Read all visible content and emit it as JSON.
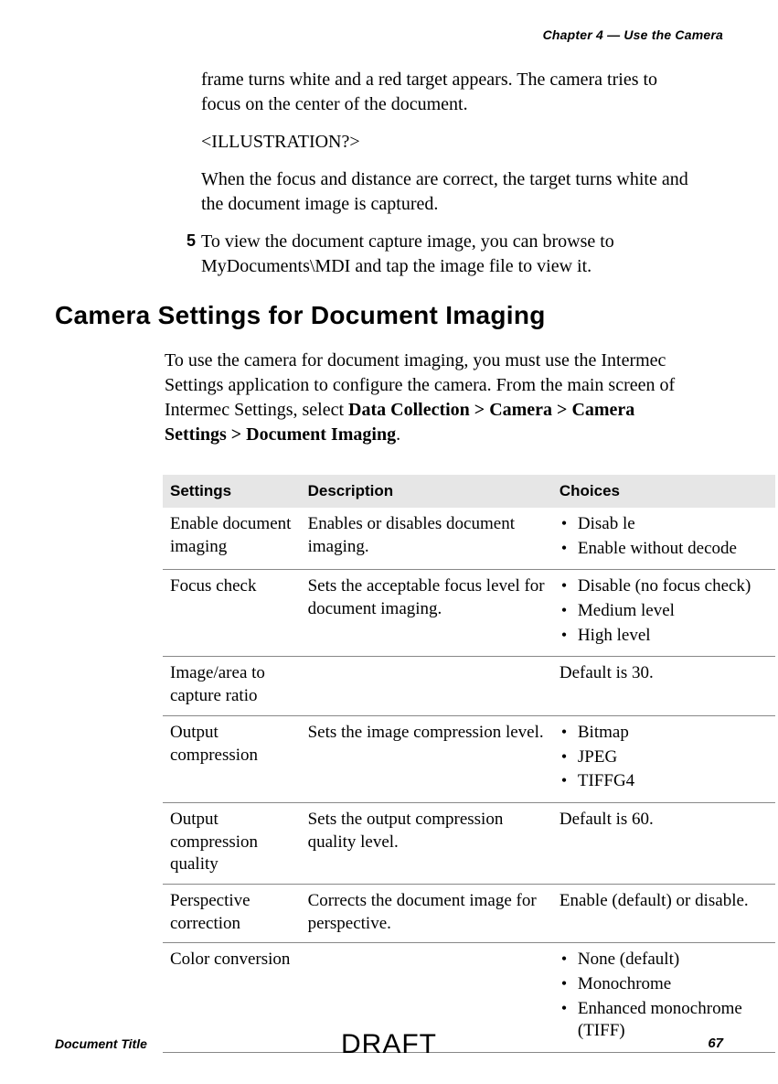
{
  "header": {
    "chapter": "Chapter 4 — Use the Camera"
  },
  "body": {
    "p1": "frame turns white and a red target appears. The camera tries to focus on the center of the document.",
    "p2": "<ILLUSTRATION?>",
    "p3": "When the focus and distance are correct, the target turns white and the document image is captured.",
    "step5_num": "5",
    "step5_text": "To view the document capture image, you can browse to MyDocuments\\MDI and tap the image file to view it."
  },
  "section": {
    "heading": "Camera Settings for Document Imaging",
    "intro_prefix": "To use the camera for document imaging, you must use the Intermec Settings application to configure the camera. From the main screen of Intermec Settings, select ",
    "intro_bold": "Data Collection > Camera > Camera Settings > Document Imaging",
    "intro_suffix": "."
  },
  "table": {
    "headers": {
      "c1": "Settings",
      "c2": "Description",
      "c3": "Choices"
    },
    "rows": [
      {
        "setting": "Enable document imaging",
        "desc": "Enables or disables document imaging.",
        "choices": [
          "Disab le",
          "Enable without decode"
        ],
        "plain": ""
      },
      {
        "setting": "Focus check",
        "desc": "Sets the acceptable focus level for document imaging.",
        "choices": [
          "Disable (no focus check)",
          "Medium level",
          "High level"
        ],
        "plain": ""
      },
      {
        "setting": "Image/area to capture ratio",
        "desc": "",
        "choices": [],
        "plain": "Default is 30."
      },
      {
        "setting": "Output compression",
        "desc": "Sets the image compression level.",
        "choices": [
          "Bitmap",
          "JPEG",
          "TIFFG4"
        ],
        "plain": ""
      },
      {
        "setting": "Output compression quality",
        "desc": "Sets the output compression quality level.",
        "choices": [],
        "plain": "Default is 60."
      },
      {
        "setting": "Perspective correction",
        "desc": "Corrects the document image for perspective.",
        "choices": [],
        "plain": "Enable (default) or disable."
      },
      {
        "setting": "Color conversion",
        "desc": "",
        "choices": [
          "None (default)",
          "Monochrome",
          "Enhanced monochrome (TIFF)"
        ],
        "plain": ""
      }
    ]
  },
  "footer": {
    "doc_title": "Document Title",
    "draft": "DRAFT",
    "page_num": "67"
  }
}
